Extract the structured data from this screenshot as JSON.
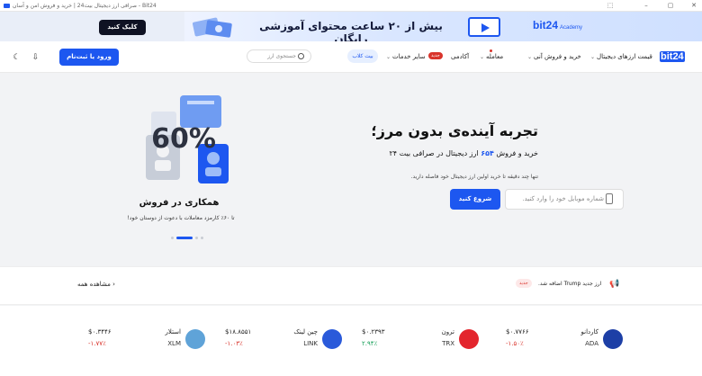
{
  "window": {
    "title": "صرافی ارز دیجیتال بیت24 | خرید و فروش امن و آسان - Bit24",
    "minimize_icon": "minimize-icon",
    "maximize_icon": "maximize-icon",
    "close_icon": "close-icon"
  },
  "banner": {
    "headline": "بیش از ۲۰ ساعت محتوای آموزشی رایگان",
    "button": "کلیک کنید",
    "logo": "bit24",
    "logo_sub": "Academy"
  },
  "nav": {
    "brand": "bit24",
    "items": [
      {
        "label": "قیمت ارزهای دیجیتال"
      },
      {
        "label": "خرید و فروش آنی"
      },
      {
        "label": "معامله"
      },
      {
        "label": "آکادمی"
      },
      {
        "label": "سایر خدمات"
      }
    ],
    "academy_badge": "جدید",
    "book_label": "بیت کلاب",
    "search_placeholder": "جستجوی ارز",
    "login_label": "ورود یا ثبت‌نام"
  },
  "hero": {
    "title": "تجربه آینده‌ی بدون مرز؛",
    "subtitle_pre": "خرید و فروش",
    "subtitle_num": "۶۵۴",
    "subtitle_post": "ارز دیجیتال در صرافی بیت ۲۴",
    "hint": "تنها چند دقیقه تا خرید اولین ارز دیجیتال خود فاصله دارید.",
    "phone_placeholder": "شماره موبایل خود را وارد کنید.",
    "start_label": "شروع کنید"
  },
  "promo": {
    "percent": "60%",
    "title": "همکاری در فروش",
    "desc": "تا ۶۰٪ کارمزد معاملات با دعوت از دوستان خود!",
    "active_index": 1
  },
  "strip": {
    "news": "ارز جدید Trump اضافه شد.",
    "new_badge": "جدید",
    "more_label": "مشاهده همه"
  },
  "coins": [
    {
      "name": "کاردانو",
      "symbol": "ADA",
      "price": "$۰.۷۷۶۶",
      "change": "-۱.۵۰٪",
      "dir": "neg",
      "color": "#1d3fa6"
    },
    {
      "name": "ترون",
      "symbol": "TRX",
      "price": "$۰.۲۳۹۳",
      "change": "۲.۹۴٪",
      "dir": "pos",
      "color": "#e3252d"
    },
    {
      "name": "چین لینک",
      "symbol": "LINK",
      "price": "$۱۸.۸۵۵۱",
      "change": "-۱.۰۳٪",
      "dir": "neg",
      "color": "#2a5ada"
    },
    {
      "name": "استلار",
      "symbol": "XLM",
      "price": "$۰.۳۴۴۶",
      "change": "-۱.۷۷٪",
      "dir": "neg",
      "color": "#5fa3d8"
    }
  ]
}
